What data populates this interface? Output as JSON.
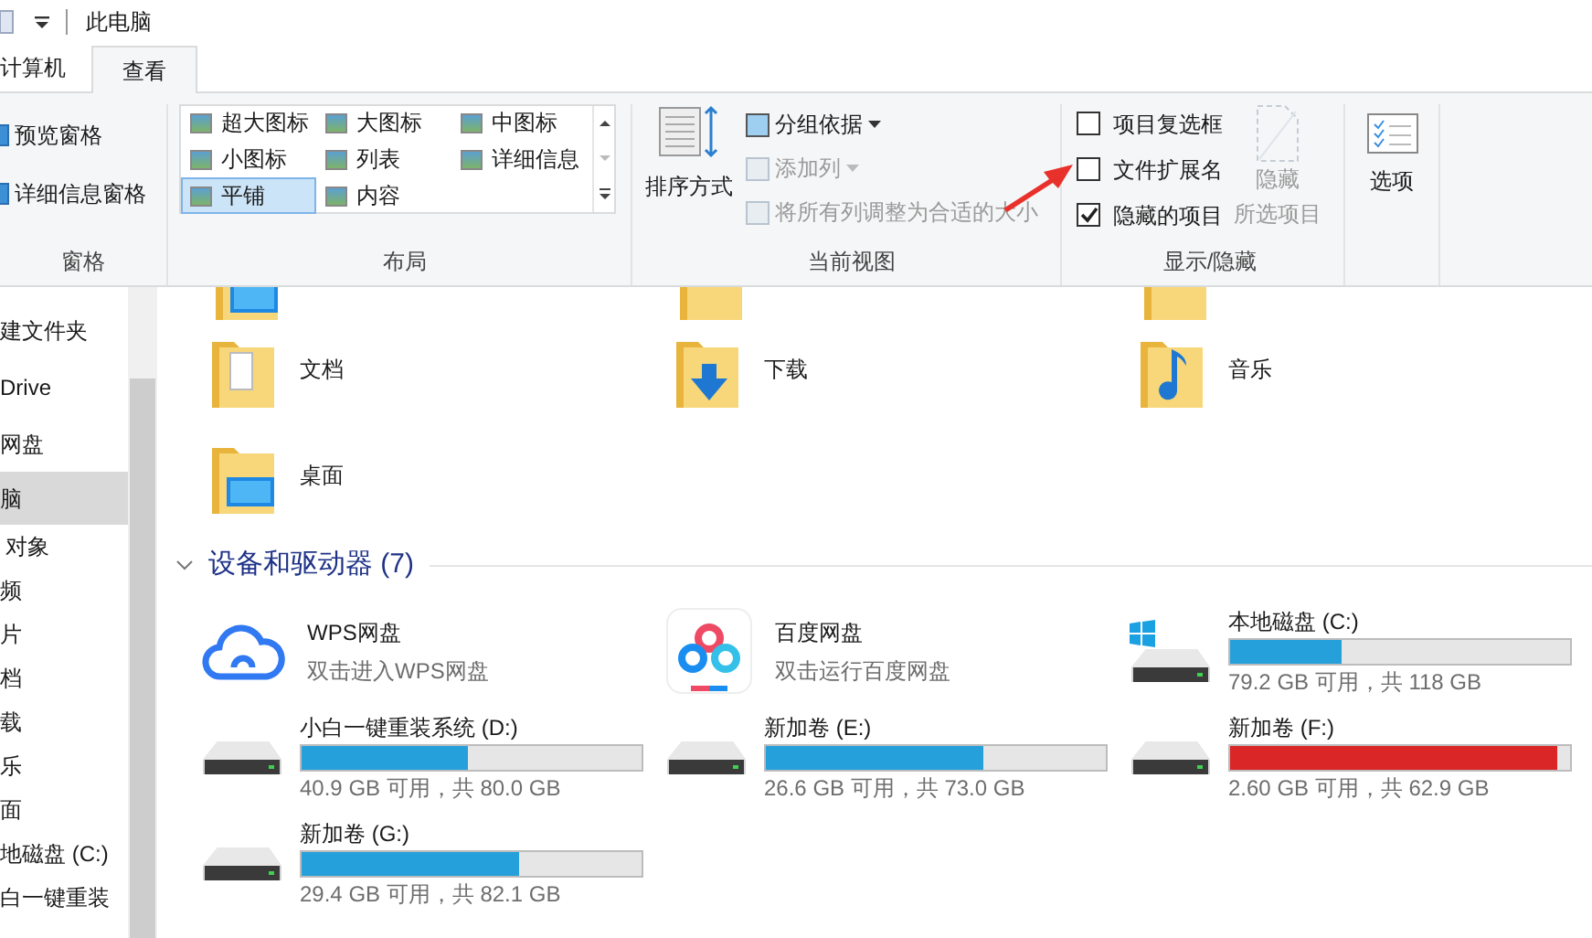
{
  "window": {
    "title": "此电脑"
  },
  "tabs": [
    {
      "label": "计算机",
      "selected": false
    },
    {
      "label": "查看",
      "selected": true
    }
  ],
  "panes_group": {
    "label": "窗格",
    "buttons": [
      "预览窗格",
      "详细信息窗格"
    ]
  },
  "layout_group": {
    "label": "布局",
    "options": [
      {
        "label": "超大图标",
        "selected": false
      },
      {
        "label": "大图标",
        "selected": false
      },
      {
        "label": "中图标",
        "selected": false
      },
      {
        "label": "小图标",
        "selected": false
      },
      {
        "label": "列表",
        "selected": false
      },
      {
        "label": "详细信息",
        "selected": false
      },
      {
        "label": "平铺",
        "selected": true
      },
      {
        "label": "内容",
        "selected": false
      }
    ]
  },
  "current_view_group": {
    "label": "当前视图",
    "sort_button": "排序方式",
    "commands": [
      {
        "label": "分组依据",
        "disabled": false,
        "dropdown": true
      },
      {
        "label": "添加列",
        "disabled": true,
        "dropdown": true
      },
      {
        "label": "将所有列调整为合适的大小",
        "disabled": true,
        "dropdown": false
      }
    ]
  },
  "show_hide_group": {
    "label": "显示/隐藏",
    "checkboxes": [
      {
        "label": "项目复选框",
        "checked": false
      },
      {
        "label": "文件扩展名",
        "checked": false
      },
      {
        "label": "隐藏的项目",
        "checked": true
      }
    ],
    "hide_button": {
      "lines": [
        "隐藏",
        "所选项目"
      ],
      "disabled": true
    }
  },
  "options_button": "选项",
  "nav_pane": {
    "items": [
      {
        "label": "建文件夹",
        "selected": false
      },
      {
        "label": "Drive",
        "selected": false
      },
      {
        "label": "网盘",
        "selected": false
      },
      {
        "label": "脑",
        "selected": true
      },
      {
        "label": "对象",
        "selected": false
      },
      {
        "label": "频",
        "selected": false
      },
      {
        "label": "片",
        "selected": false
      },
      {
        "label": "档",
        "selected": false
      },
      {
        "label": "载",
        "selected": false
      },
      {
        "label": "乐",
        "selected": false
      },
      {
        "label": "面",
        "selected": false
      },
      {
        "label": "地磁盘 (C:)",
        "selected": false
      },
      {
        "label": "白一键重装",
        "selected": false
      }
    ]
  },
  "folders": [
    {
      "name": "文档",
      "kind": "documents"
    },
    {
      "name": "下载",
      "kind": "downloads"
    },
    {
      "name": "音乐",
      "kind": "music"
    },
    {
      "name": "桌面",
      "kind": "desktop"
    }
  ],
  "devices_section": {
    "title": "设备和驱动器 (7)",
    "expanded": true
  },
  "devices": [
    {
      "kind": "cloud",
      "name": "WPS网盘",
      "subtitle": "双击进入WPS网盘"
    },
    {
      "kind": "baidu",
      "name": "百度网盘",
      "subtitle": "双击运行百度网盘"
    },
    {
      "kind": "drive",
      "name": "本地磁盘 (C:)",
      "system": true,
      "level": 0.33,
      "color": "#26a0da",
      "free": "79.2 GB 可用，共 118 GB"
    },
    {
      "kind": "drive",
      "name": "小白一键重装系统 (D:)",
      "system": false,
      "level": 0.49,
      "color": "#26a0da",
      "free": "40.9 GB 可用，共 80.0 GB"
    },
    {
      "kind": "drive",
      "name": "新加卷 (E:)",
      "system": false,
      "level": 0.64,
      "color": "#26a0da",
      "free": "26.6 GB 可用，共 73.0 GB"
    },
    {
      "kind": "drive",
      "name": "新加卷 (F:)",
      "system": false,
      "level": 0.96,
      "color": "#da2626",
      "free": "2.60 GB 可用，共 62.9 GB"
    },
    {
      "kind": "drive",
      "name": "新加卷 (G:)",
      "system": false,
      "level": 0.64,
      "color": "#26a0da",
      "free": "29.4 GB 可用，共 82.1 GB"
    }
  ]
}
